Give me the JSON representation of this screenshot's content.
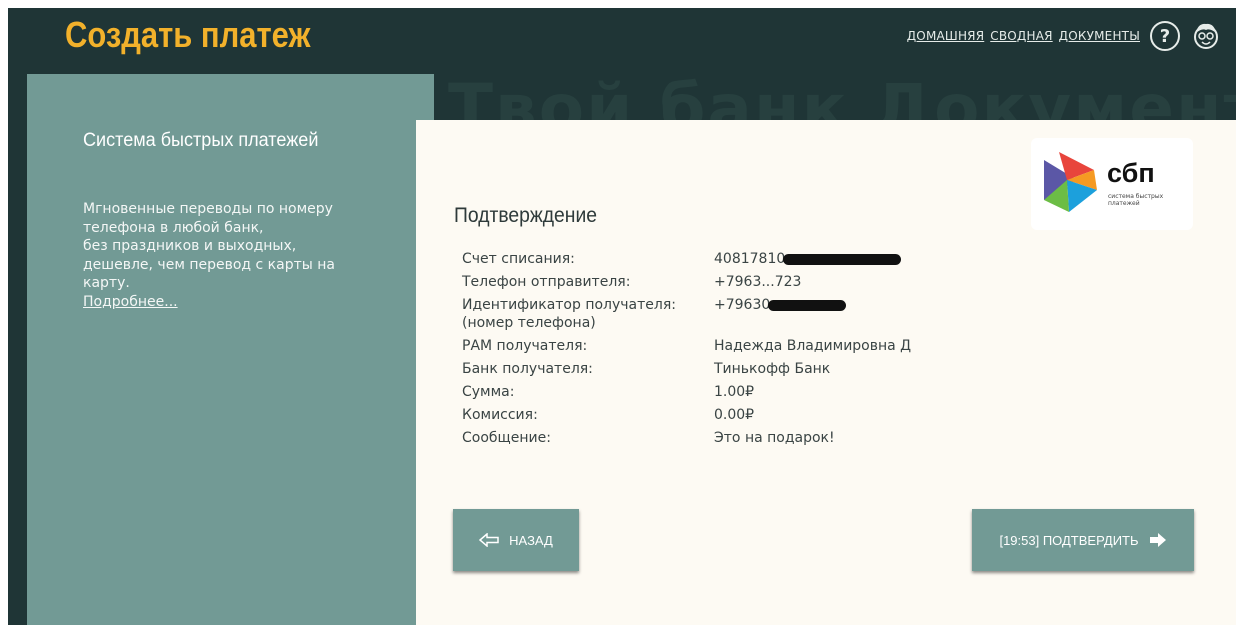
{
  "header": {
    "title": "Создать платеж",
    "nav": [
      "ДОМАШНЯЯ",
      "СВОДНАЯ",
      "ДОКУМЕНТЫ"
    ],
    "help_label": "?",
    "icons": [
      "help-icon",
      "avatar-icon"
    ]
  },
  "background": {
    "text": "Твой банк   Документы"
  },
  "sidebar": {
    "title": "Система быстрых платежей",
    "text_lines": [
      "Мгновенные переводы по номеру",
      "телефона в любой банк,",
      "без праздников и выходных,",
      "дешевле, чем перевод с карты на",
      "карту."
    ],
    "more_link": "Подробнее..."
  },
  "logo": {
    "word": "сбп",
    "subtitle": "система быстрых платежей"
  },
  "confirmation": {
    "title": "Подтверждение",
    "rows": [
      {
        "label": "Счет списания:",
        "value": "40817810"
      },
      {
        "label": "Телефон отправителя:",
        "value": "+7963...723"
      },
      {
        "label": "Идентификатор получателя:",
        "label2": "(номер телефона)",
        "value": "+79630"
      },
      {
        "label": "РАМ получателя:",
        "value": "Надежда Владимировна Д"
      },
      {
        "label": "Банк получателя:",
        "value": "Тинькофф Банк"
      },
      {
        "label": "Сумма:",
        "value": "1.00₽"
      },
      {
        "label": "Комиссия:",
        "value": "0.00₽"
      },
      {
        "label": "Сообщение:",
        "value": "Это на подарок!"
      }
    ]
  },
  "buttons": {
    "back": "НАЗАД",
    "confirm": "[19:53] ПОДТВЕРДИТЬ"
  }
}
